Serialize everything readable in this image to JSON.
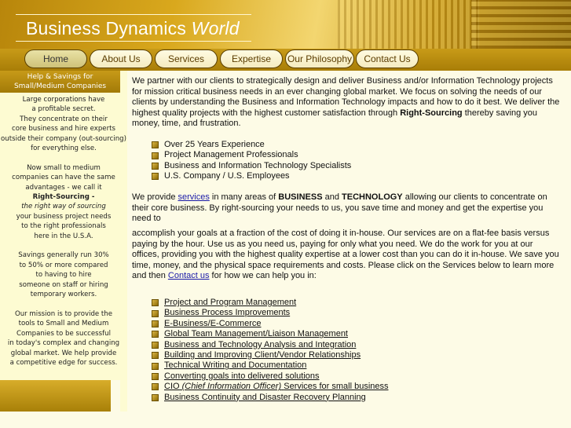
{
  "header": {
    "title_main": "Business Dynamics",
    "title_em": "World"
  },
  "nav": {
    "items": [
      "Home",
      "About Us",
      "Services",
      "Expertise",
      "Our Philosophy",
      "Contact Us"
    ],
    "active": "Home"
  },
  "sidebar": {
    "heading_line1": "Help & Savings  for",
    "heading_line2": "Small/Medium Companies",
    "block1": "Large corporations have\na profitable secret.\nThey concentrate on their\ncore business and hire experts\noutside their company (out-sourcing)\nfor everything else.",
    "block2_a": "Now small to medium\ncompanies can have the same\nadvantages - we call it",
    "block2_b": "Right-Sourcing -",
    "block2_c": "the right way of sourcing",
    "block2_d": "your business project needs\nto the right professionals\nhere in the U.S.A.",
    "block3": "Savings generally run 30%\nto 50% or more compared\nto  having to hire\nsomeone on staff or hiring\ntemporary workers.",
    "block4": "Our mission is to provide the\ntools to Small and Medium\nCompanies to be successful\nin today's complex and changing\nglobal market. We help provide\na competitive edge for success."
  },
  "main": {
    "intro_a": "We partner with our clients to strategically design and deliver Business and/or Information Technology projects for mission critical business needs in an ever changing global market. We focus on solving the needs of our clients by understanding the Business and Information Technology impacts and how to do it best.  We deliver the highest quality projects with the highest customer satisfaction through",
    "intro_bold": "Right-Sourcing",
    "intro_b": "thereby saving you money, time, and frustration.",
    "highlights": [
      "Over 25 Years Experience",
      "Project Management Professionals",
      "Business and Information Technology Specialists",
      "U.S. Company / U.S. Employees"
    ],
    "p2_a": "We provide",
    "p2_link": "services",
    "p2_b": "in many areas of",
    "p2_bold1": "BUSINESS",
    "p2_and": "and",
    "p2_bold2": "TECHNOLOGY",
    "p2_c": "allowing our clients to concentrate on their core business.  By right-sourcing your needs to us, you save time and money and get the expertise you need to",
    "p3_a": "accomplish your goals at a fraction of the cost of doing it in-house.  Our services are on a flat-fee basis versus paying by the hour.  Use us as you need us, paying for only what you need.  We do the work for you at our offices, providing you with the highest quality expertise at a lower cost than you can do it in-house.  We save you time, money, and the physical space requirements and costs.  Please click on the Services below to learn more and then",
    "p3_link": "Contact us",
    "p3_b": "for how we can help you in:",
    "services": [
      "Project and Program Management",
      "Business Process Improvements",
      "E-Business/E-Commerce",
      "Global Team Management/Liaison Management",
      "Business and Technology Analysis and Integration",
      "Building and Improving Client/Vendor Relationships",
      "Technical Writing and Documentation",
      "Converting goals into delivered solutions"
    ],
    "service_cio_a": "CIO",
    "service_cio_em": "(Chief Information Officer)",
    "service_cio_b": "Services for small business",
    "service_last": "Business Continuity and Disaster Recovery Planning"
  }
}
